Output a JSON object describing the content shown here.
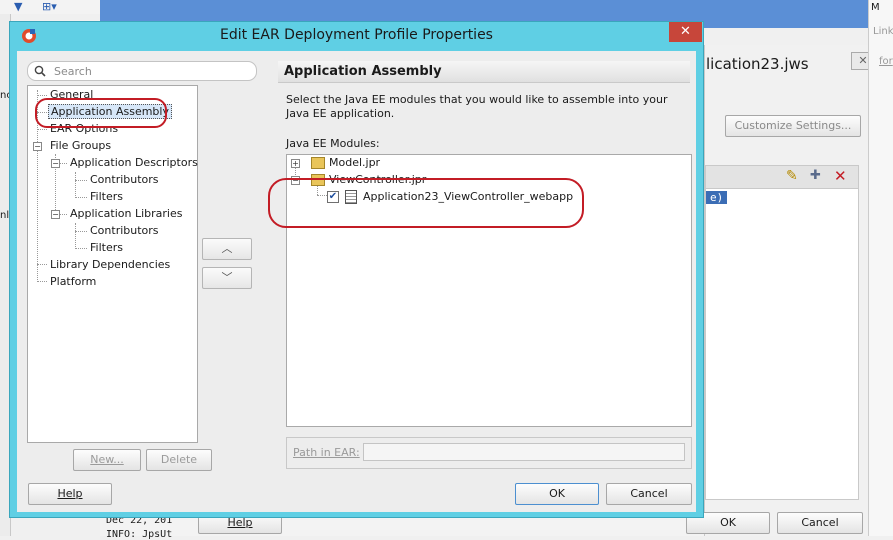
{
  "dialog": {
    "title": "Edit EAR Deployment Profile Properties",
    "close_label": "✕"
  },
  "search": {
    "placeholder": "Search"
  },
  "nav": {
    "general": "General",
    "application_assembly": "Application Assembly",
    "ear_options": "EAR Options",
    "file_groups": "File Groups",
    "app_descriptors": "Application Descriptors",
    "contributors": "Contributors",
    "filters": "Filters",
    "app_libraries": "Application Libraries",
    "library_dependencies": "Library Dependencies",
    "platform": "Platform"
  },
  "order": {
    "up": "︿",
    "down": "﹀"
  },
  "buttons": {
    "new": "New...",
    "delete": "Delete",
    "help": "Help",
    "ok": "OK",
    "cancel": "Cancel"
  },
  "panel": {
    "heading": "Application Assembly",
    "description": "Select the Java EE modules that you would like to assemble into your Java EE application.",
    "modules_label": "Java EE Modules:",
    "modules": [
      {
        "label": "Model.jpr"
      },
      {
        "label": "ViewController.jpr"
      },
      {
        "label": "Application23_ViewController_webapp",
        "checked": true
      }
    ],
    "path_label": "Path in EAR:",
    "path_value": ""
  },
  "background": {
    "workspace_title": "lication23.jws",
    "customize_button": "Customize Settings...",
    "selection_tag": "e)",
    "help": "Help",
    "ok": "OK",
    "cancel": "Cancel",
    "log_line1": "Dec 22, 201",
    "log_line2": "INFO: JpsUt",
    "right_tab": "M",
    "right_link": "Link",
    "right_link2": "for",
    "left_label1": "nc",
    "left_label2": "nl"
  },
  "colors": {
    "title_bar": "#5fcfe4",
    "annotation_ring": "#c31c25",
    "close_button": "#c7463a"
  }
}
